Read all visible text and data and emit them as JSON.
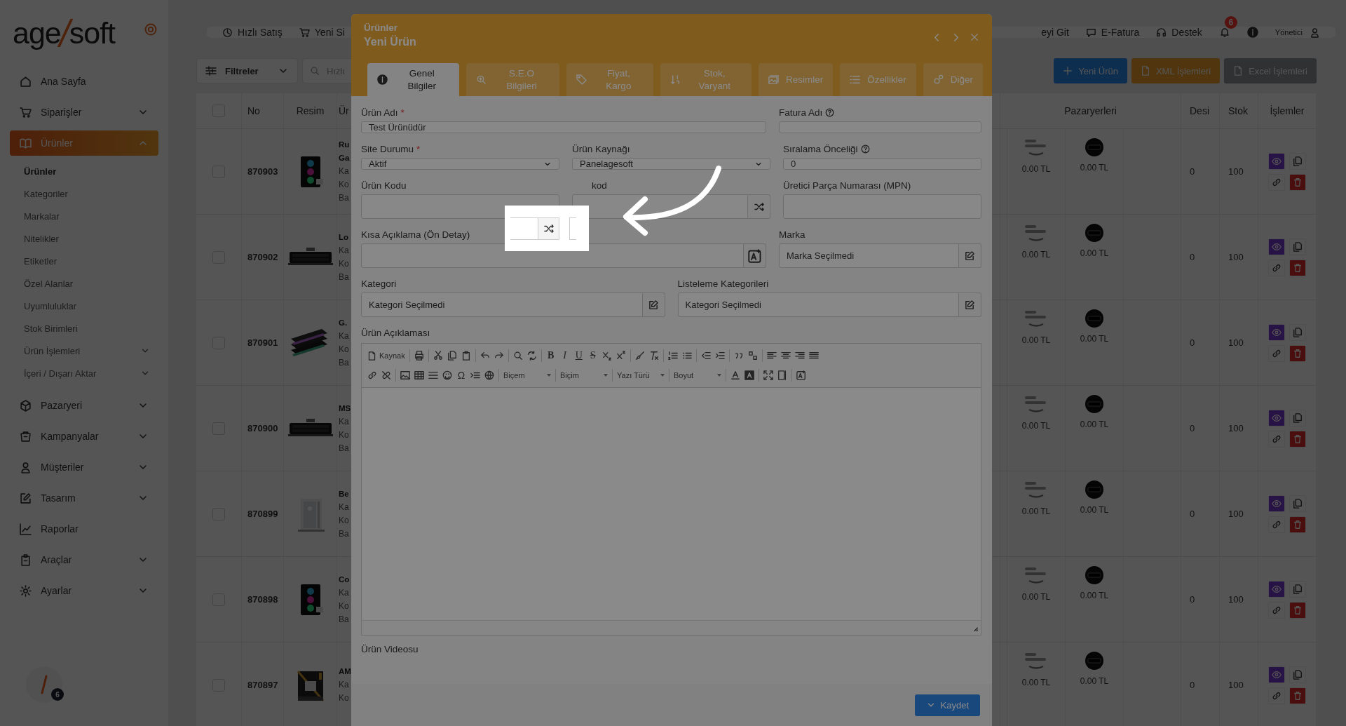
{
  "logo": {
    "left": "age",
    "right": "soft"
  },
  "sidebar": {
    "items": [
      {
        "label": "Ana Sayfa",
        "kind": "link",
        "selected": false
      },
      {
        "label": "Siparişler",
        "kind": "group",
        "expanded": false,
        "selected": false
      },
      {
        "label": "Ürünler",
        "kind": "group",
        "expanded": true,
        "selected": true,
        "children": [
          {
            "label": "Ürünler",
            "kind": "link",
            "selected": true
          },
          {
            "label": "Kategoriler",
            "kind": "link",
            "selected": false
          },
          {
            "label": "Markalar",
            "kind": "link",
            "selected": false
          },
          {
            "label": "Nitelikler",
            "kind": "link",
            "selected": false
          },
          {
            "label": "Etiketler",
            "kind": "link",
            "selected": false
          },
          {
            "label": "Özel Alanlar",
            "kind": "link",
            "selected": false
          },
          {
            "label": "Uyumluluklar",
            "kind": "link",
            "selected": false
          },
          {
            "label": "Stok Birimleri",
            "kind": "link",
            "selected": false
          },
          {
            "label": "Ürün İşlemleri",
            "kind": "group",
            "expanded": false,
            "selected": false
          },
          {
            "label": "İçeri / Dışarı Aktar",
            "kind": "group",
            "expanded": false,
            "selected": false
          }
        ]
      },
      {
        "label": "Pazaryeri",
        "kind": "group",
        "expanded": false,
        "selected": false
      },
      {
        "label": "Kampanyalar",
        "kind": "group",
        "expanded": false,
        "selected": false
      },
      {
        "label": "Müşteriler",
        "kind": "group",
        "expanded": false,
        "selected": false
      },
      {
        "label": "Tasarım",
        "kind": "group",
        "expanded": false,
        "selected": false
      },
      {
        "label": "Raporlar",
        "kind": "link",
        "selected": false
      },
      {
        "label": "Araçlar",
        "kind": "group",
        "expanded": false,
        "selected": false
      },
      {
        "label": "Ayarlar",
        "kind": "group",
        "expanded": false,
        "selected": false
      }
    ],
    "avatar_badge": "6"
  },
  "topbar": {
    "left": [
      "Hızlı Satış",
      "Yeni Si"
    ],
    "right": [
      "eyi Git",
      "E-Fatura",
      "Destek"
    ],
    "notifications": "6",
    "user": "Yönetici"
  },
  "toolbar": {
    "filter": "Filtreler",
    "search_placeholder": "Hızlı",
    "buttons": [
      {
        "label": "Yeni Ürün",
        "kind": "primary"
      },
      {
        "label": "XML İşlemleri",
        "kind": "warning"
      },
      {
        "label": "Excel İşlemleri",
        "kind": "secondary"
      }
    ]
  },
  "table": {
    "select_all_checked": false,
    "columns": [
      "No",
      "Resim",
      "Ür",
      "Pazaryerleri",
      "Desi",
      "Stok",
      "İşlemler"
    ],
    "rows": [
      {
        "checked": false,
        "no": "870903",
        "title": [
          "Ru",
          "Ga"
        ],
        "lines": [
          "Ka",
          "Ko",
          "Ba"
        ],
        "prices": [
          "0.00 TL",
          "0.00 TL"
        ],
        "desi": "0",
        "stock": "100"
      },
      {
        "checked": false,
        "no": "870902",
        "title": [
          "Lo"
        ],
        "lines": [
          "Ka",
          "Ko",
          "Ba"
        ],
        "prices": [
          "0.00 TL",
          "0.00 TL"
        ],
        "desi": "0",
        "stock": "100"
      },
      {
        "checked": false,
        "no": "870901",
        "title": [
          "G."
        ],
        "lines": [
          "Ka",
          "Ko",
          "Ba"
        ],
        "prices": [
          "0.00 TL",
          "0.00 TL"
        ],
        "desi": "0",
        "stock": "100"
      },
      {
        "checked": false,
        "no": "870900",
        "title": [
          "MS"
        ],
        "lines": [
          "Ka",
          "Ko",
          "Ba"
        ],
        "prices": [
          "0.00 TL",
          "0.00 TL"
        ],
        "desi": "0",
        "stock": "100"
      },
      {
        "checked": false,
        "no": "870899",
        "title": [
          "Be"
        ],
        "lines": [
          "Ka",
          "Ko",
          "Ba"
        ],
        "prices": [
          "0.00 TL",
          "0.00 TL"
        ],
        "desi": "0",
        "stock": "100"
      },
      {
        "checked": false,
        "no": "870898",
        "title": [
          "Co"
        ],
        "lines": [
          "Ka",
          "Ko",
          "Ba"
        ],
        "prices": [
          "0.00 TL",
          "0.00 TL"
        ],
        "desi": "0",
        "stock": "100"
      },
      {
        "checked": false,
        "no": "870897",
        "title": [
          "AM"
        ],
        "lines": [
          "Ka",
          "Ko"
        ],
        "prices": [
          "0.00 TL",
          "0.00 TL"
        ],
        "desi": "0",
        "stock": "100"
      }
    ]
  },
  "modal": {
    "breadcrumb": "Ürünler",
    "title": "Yeni Ürün",
    "tabs": [
      {
        "label": "Genel Bilgiler",
        "selected": true
      },
      {
        "label": "S.E.O Bilgileri",
        "selected": false
      },
      {
        "label": "Fiyat, Kargo",
        "selected": false
      },
      {
        "label": "Stok, Varyant",
        "selected": false
      },
      {
        "label": "Resimler",
        "selected": false
      },
      {
        "label": "Özellikler",
        "selected": false
      },
      {
        "label": "Diğer",
        "selected": false
      }
    ],
    "form_rows": [
      [
        {
          "label": "Ürün Adı",
          "required_mark": "*",
          "help": false,
          "kind": "text",
          "value": "Test Ürünüdür"
        },
        {
          "label": "Fatura Adı",
          "help": true,
          "kind": "text"
        }
      ],
      [
        {
          "label": "Site Durumu",
          "required_mark": "*",
          "help": false,
          "kind": "select",
          "value": "Aktif"
        },
        {
          "label": "Ürün Kaynağı",
          "help": false,
          "kind": "select",
          "value": "Panelagesoft"
        },
        {
          "label": "Sıralama Önceliği",
          "help": true,
          "kind": "text",
          "value": "0"
        }
      ],
      [
        {
          "label": "Ürün Kodu",
          "help": false,
          "kind": "text"
        },
        {
          "label": "kod",
          "help": false,
          "kind": "generate"
        },
        {
          "label": "Üretici Parça Numarası (MPN)",
          "help": false,
          "kind": "text"
        }
      ],
      [
        {
          "label": "Kısa Açıklama (Ön Detay)",
          "help": false,
          "kind": "ai"
        },
        {
          "label": "Marka",
          "help": false,
          "kind": "picker",
          "value": "Marka Seçilmedi"
        }
      ],
      [
        {
          "label": "Kategori",
          "help": false,
          "kind": "picker",
          "value": "Kategori Seçilmedi"
        },
        {
          "label": "Listeleme Kategorileri",
          "help": false,
          "kind": "picker",
          "value": "Kategori Seçilmedi"
        }
      ]
    ],
    "editor": {
      "label": "Ürün Açıklaması",
      "source": "Kaynak",
      "letters": [
        "B",
        "I",
        "U",
        "S"
      ],
      "omega": "Ω",
      "combos": [
        "Biçem",
        "Biçim",
        "Yazı Türü",
        "Boyut"
      ]
    },
    "video_label": "Ürün Videosu",
    "save": "Kaydet"
  }
}
